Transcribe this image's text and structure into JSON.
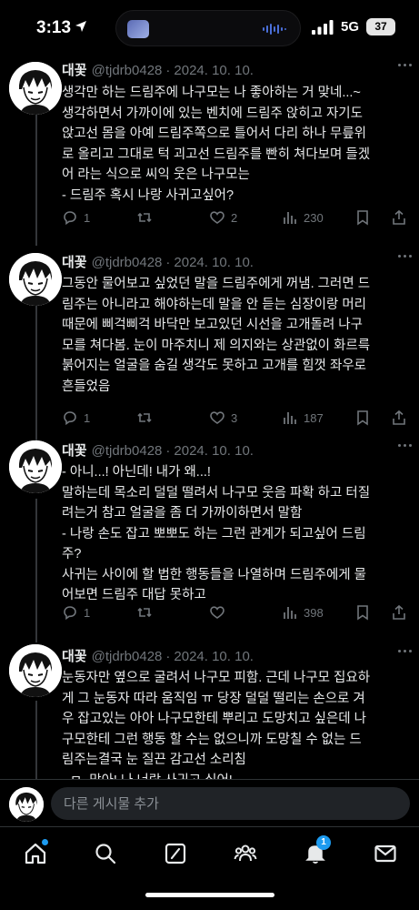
{
  "status_bar": {
    "time": "3:13",
    "network": "5G",
    "battery": "37",
    "icons": [
      "location-arrow-icon",
      "signal-bars-icon",
      "battery-icon"
    ]
  },
  "posts": [
    {
      "name": "대꽃",
      "handle": "@tjdrb0428",
      "date": "2024. 10. 10.",
      "lines": [
        "생각만 하는 드림주에 나구모는 나 좋아하는 거 맞네...~",
        "생각하면서 가까이에 있는 벤치에 드림주 앉히고 자기도",
        "앉고선 몸을 아예 드림주쪽으로 틀어서 다리 하나 무릎위",
        "로 올리고 그대로 턱 괴고선 드림주를 빤히 쳐다보며 들겠",
        "어 라는 식으로 씨익 웃은 나구모는",
        "- 드림주 혹시 나랑 사귀고싶어?"
      ],
      "replies": "1",
      "retweets": "",
      "likes": "2",
      "views": "230"
    },
    {
      "name": "대꽃",
      "handle": "@tjdrb0428",
      "date": "2024. 10. 10.",
      "lines": [
        "그동안 물어보고 싶었던 말을 드림주에게 꺼냄. 그러면 드",
        "림주는 아니라고 해야하는데 말을 안 듣는 심장이랑 머리",
        "때문에 삐걱삐걱 바닥만 보고있던 시선을 고개돌려 나구",
        "모를 쳐다봄. 눈이 마주치니 제 의지와는 상관없이 화르륵",
        "붉어지는 얼굴을 숨길 생각도 못하고 고개를 힘껏 좌우로",
        "흔들었음"
      ],
      "replies": "1",
      "retweets": "",
      "likes": "3",
      "views": "187"
    },
    {
      "name": "대꽃",
      "handle": "@tjdrb0428",
      "date": "2024. 10. 10.",
      "lines": [
        "- 아니...! 아닌데! 내가 왜...!",
        "말하는데 목소리 덜덜 떨려서 나구모 웃음 파확 하고 터질",
        "려는거 참고 얼굴을 좀 더 가까이하면서 말함",
        "- 나랑 손도 잡고 뽀뽀도 하는 그런 관계가 되고싶어 드림",
        "주?",
        "사귀는 사이에 할 법한 행동들을 나열하며 드림주에게 물",
        "어보면 드림주 대답 못하고"
      ],
      "replies": "1",
      "retweets": "",
      "likes": "",
      "views": "398"
    },
    {
      "name": "대꽃",
      "handle": "@tjdrb0428",
      "date": "2024. 10. 10.",
      "lines": [
        "눈동자만 옆으로 굴려서 나구모 피함. 근데 나구모 집요하",
        "게 그 눈동자 따라 움직임 ㅠ 당장 덜덜 떨리는 손으로 겨",
        "우 잡고있는 아아 나구모한테 뿌리고 도망치고 싶은데 나",
        "구모한테 그런 행동 할 수는 없으니까 도망칠 수 없는 드",
        "림주는결국 눈 질끈 감고선 소리침",
        "- ㅁ..맞아! 나 너랑 사귀고 싶어!"
      ],
      "replies": "",
      "retweets": "",
      "likes": "",
      "views": ""
    }
  ],
  "reply_bar": {
    "placeholder": "다른 게시물 추가"
  },
  "bottom_nav": {
    "items": [
      "home-icon",
      "search-icon",
      "compose-icon",
      "communities-icon",
      "notifications-icon",
      "messages-icon"
    ],
    "notification_count": "1"
  },
  "colors": {
    "background": "#000000",
    "text": "#e7e9ea",
    "muted": "#71767b",
    "accent": "#1d9bf0"
  }
}
